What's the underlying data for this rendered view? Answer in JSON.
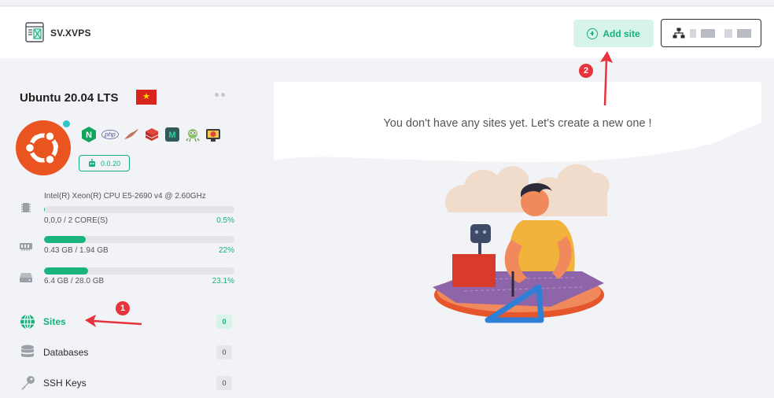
{
  "header": {
    "brand": "SV.XVPS",
    "add_site_label": "Add site"
  },
  "server": {
    "name": "Ubuntu 20.04 LTS",
    "flag": "vietnam-flag",
    "agent_version": "0.0.20",
    "stack": [
      "nginx-icon",
      "php-icon",
      "mariadb-icon",
      "redis-icon",
      "memcached-icon",
      "bug-icon",
      "monitor-icon"
    ]
  },
  "resources": {
    "cpu": {
      "model": "Intel(R) Xeon(R) CPU E5-2690 v4 @ 2.60GHz",
      "usage": "0,0,0 / 2 CORE(S)",
      "percent": "0.5%",
      "fraction": 0.005
    },
    "ram": {
      "usage": "0.43 GB / 1.94 GB",
      "percent": "22%",
      "fraction": 0.22
    },
    "disk": {
      "usage": "6.4 GB / 28.0 GB",
      "percent": "23.1%",
      "fraction": 0.231
    }
  },
  "nav": [
    {
      "label": "Sites",
      "count": "0",
      "active": true,
      "icon": "globe-icon"
    },
    {
      "label": "Databases",
      "count": "0",
      "active": false,
      "icon": "database-icon"
    },
    {
      "label": "SSH Keys",
      "count": "0",
      "active": false,
      "icon": "key-icon"
    }
  ],
  "main": {
    "empty_message": "You don't have any sites yet. Let's create a new one !"
  },
  "annotations": {
    "one": "1",
    "two": "2"
  },
  "colors": {
    "accent": "#17b07a",
    "accent_bg": "#d6f4ea",
    "ubuntu": "#e95420",
    "annotation": "#e8323c"
  }
}
